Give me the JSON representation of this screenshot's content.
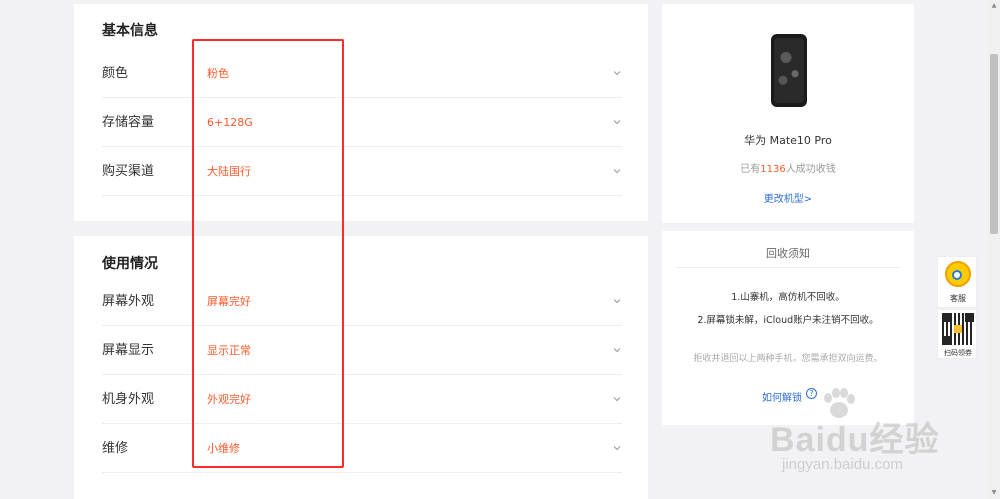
{
  "basic_info": {
    "title": "基本信息",
    "rows": [
      {
        "label": "颜色",
        "value": "粉色"
      },
      {
        "label": "存储容量",
        "value": "6+128G"
      },
      {
        "label": "购买渠道",
        "value": "大陆国行"
      }
    ]
  },
  "usage": {
    "title": "使用情况",
    "rows": [
      {
        "label": "屏幕外观",
        "value": "屏幕完好"
      },
      {
        "label": "屏幕显示",
        "value": "显示正常"
      },
      {
        "label": "机身外观",
        "value": "外观完好"
      },
      {
        "label": "维修",
        "value": "小维修"
      }
    ]
  },
  "phone": {
    "name": "华为 Mate10 Pro",
    "count_prefix": "已有",
    "count_number": "1136",
    "count_suffix": "人成功收钱",
    "change_model": "更改机型>"
  },
  "notice": {
    "title": "回收须知",
    "line1": "1.山寨机，高仿机不回收。",
    "line2": "2.屏幕锁未解，iCloud账户未注销不回收。",
    "grey_text": "拒收并退回以上两种手机，您需承担双向运费。",
    "unlock_link": "如何解锁",
    "help_icon": "?"
  },
  "float": {
    "service_label": "客服",
    "qr_label": "扫码领券"
  },
  "watermark": {
    "text": "Baidu经验",
    "url": "jingyan.baidu.com"
  },
  "colors": {
    "accent": "#ff5a2b",
    "link": "#2d6ed6",
    "highlight_box": "#ff2a2a"
  }
}
